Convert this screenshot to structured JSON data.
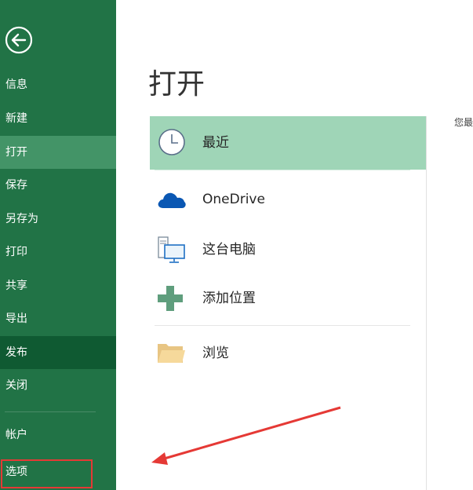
{
  "sidebar": {
    "items": [
      {
        "label": "信息"
      },
      {
        "label": "新建"
      },
      {
        "label": "打开"
      },
      {
        "label": "保存"
      },
      {
        "label": "另存为"
      },
      {
        "label": "打印"
      },
      {
        "label": "共享"
      },
      {
        "label": "导出"
      },
      {
        "label": "发布"
      },
      {
        "label": "关闭"
      },
      {
        "label": "帐户"
      },
      {
        "label": "选项"
      }
    ],
    "active_item": "打开",
    "back_icon": "back-arrow-icon"
  },
  "main": {
    "title": "打开",
    "places": [
      {
        "label": "最近",
        "icon": "clock-icon",
        "selected": true
      },
      {
        "label": "OneDrive",
        "icon": "cloud-icon"
      },
      {
        "label": "这台电脑",
        "icon": "computer-icon"
      },
      {
        "label": "添加位置",
        "icon": "plus-icon"
      },
      {
        "label": "浏览",
        "icon": "folder-icon"
      }
    ],
    "recent_hint": "您最"
  },
  "colors": {
    "sidebar_bg": "#217346",
    "sidebar_active": "#439467",
    "sidebar_dark": "#0f5a32",
    "selected_place": "#9fd5b7",
    "annotation_red": "#e53935"
  }
}
